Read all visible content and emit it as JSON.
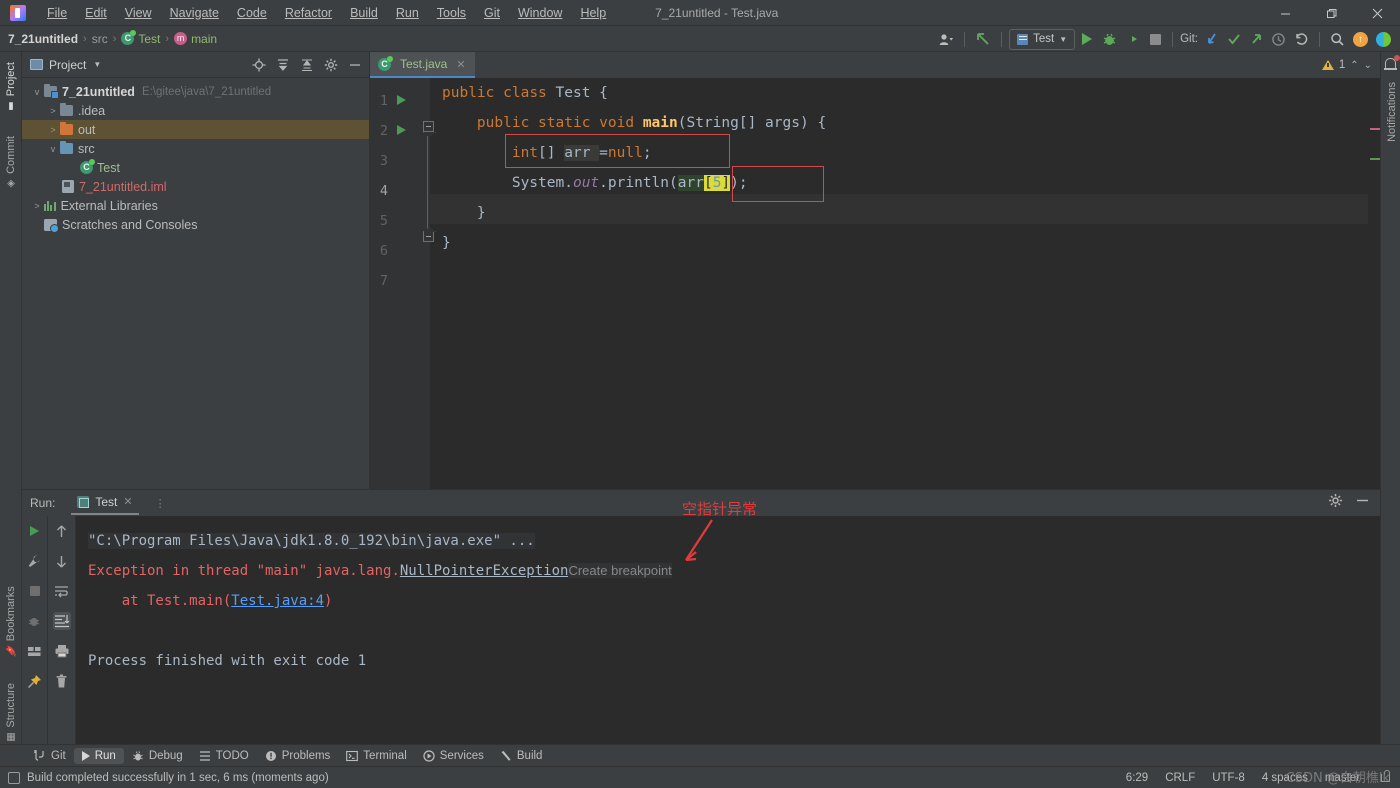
{
  "window": {
    "title": "7_21untitled - Test.java",
    "controls": {
      "minimize": "—",
      "maximize": "❐",
      "close": "✕"
    }
  },
  "menu": [
    {
      "label": "File"
    },
    {
      "label": "Edit"
    },
    {
      "label": "View"
    },
    {
      "label": "Navigate"
    },
    {
      "label": "Code"
    },
    {
      "label": "Refactor"
    },
    {
      "label": "Build"
    },
    {
      "label": "Run"
    },
    {
      "label": "Tools"
    },
    {
      "label": "Git"
    },
    {
      "label": "Window"
    },
    {
      "label": "Help"
    }
  ],
  "breadcrumb": {
    "project": "7_21untitled",
    "sep": "›",
    "src": "src",
    "class": "Test",
    "method": "main"
  },
  "toolbar": {
    "run_config": "Test",
    "git_label": "Git:",
    "icons": [
      "user-icon",
      "update-project-icon",
      "run-icon",
      "debug-icon",
      "run-coverage-icon",
      "stop-icon",
      "git-update-icon",
      "git-commit-icon",
      "git-push-icon",
      "git-history-icon",
      "git-rollback-icon",
      "search-icon",
      "notification-icon",
      "ide-feature-icon"
    ]
  },
  "left_strip": [
    {
      "label": "Project",
      "selected": true
    },
    {
      "label": "Commit",
      "selected": false
    }
  ],
  "left_strip_bottom": [
    {
      "label": "Bookmarks"
    },
    {
      "label": "Structure"
    }
  ],
  "right_strip": [
    {
      "label": "Notifications"
    }
  ],
  "project_panel": {
    "title": "Project",
    "actions": [
      "locate-icon",
      "expand-all-icon",
      "collapse-all-icon",
      "settings-icon",
      "hide-icon"
    ],
    "tree": [
      {
        "indent": 0,
        "arrow": "v",
        "icon": "module-folder",
        "label": "7_21untitled",
        "bold": true,
        "path": "E:\\gitee\\java\\7_21untitled",
        "selected": false
      },
      {
        "indent": 1,
        "arrow": ">",
        "icon": "folder-gray",
        "label": ".idea",
        "bold": false,
        "path": "",
        "selected": false
      },
      {
        "indent": 1,
        "arrow": ">",
        "icon": "folder-orange",
        "label": "out",
        "bold": false,
        "path": "",
        "selected": true
      },
      {
        "indent": 1,
        "arrow": "v",
        "icon": "folder-blue",
        "label": "src",
        "bold": false,
        "path": "",
        "selected": false
      },
      {
        "indent": 2,
        "arrow": "",
        "icon": "java-class",
        "label": "Test",
        "bold": false,
        "path": "",
        "selected": false
      },
      {
        "indent": 1,
        "arrow": "",
        "icon": "iml-file",
        "label": "7_21untitled.iml",
        "bold": false,
        "path": "",
        "selected": false
      },
      {
        "indent": 0,
        "arrow": ">",
        "icon": "libraries",
        "label": "External Libraries",
        "bold": false,
        "path": "",
        "selected": false
      },
      {
        "indent": 0,
        "arrow": "",
        "icon": "scratches",
        "label": "Scratches and Consoles",
        "bold": false,
        "path": "",
        "selected": false
      }
    ]
  },
  "editor": {
    "tab": {
      "label": "Test.java",
      "close": "✕"
    },
    "warnings": {
      "count": "1",
      "icon": "warning-triangle-icon"
    },
    "lines": [
      {
        "n": "1",
        "run_marker": true
      },
      {
        "n": "2",
        "run_marker": true
      },
      {
        "n": "3",
        "run_marker": false
      },
      {
        "n": "4",
        "run_marker": false
      },
      {
        "n": "5",
        "run_marker": false
      },
      {
        "n": "6",
        "run_marker": false
      },
      {
        "n": "7",
        "run_marker": false
      }
    ],
    "code": {
      "l1": "public class Test {",
      "l2": "public static void main(String[] args) {",
      "l3": "int[] arr =null;",
      "l4": "System.out.println(arr[5]);",
      "l5": "}",
      "l6": "}"
    }
  },
  "run_panel": {
    "label": "Run:",
    "tab": "Test",
    "tools_left": [
      "rerun-icon",
      "settings-wrench-icon",
      "stop-icon",
      "debug-icon",
      "layout-icon",
      "pin-icon"
    ],
    "tools_right": [
      "up-arrow-icon",
      "down-arrow-icon",
      "soft-wrap-icon",
      "scroll-to-end-icon",
      "print-icon",
      "trash-icon"
    ],
    "console": {
      "cmd": "\"C:\\Program Files\\Java\\jdk1.8.0_192\\bin\\java.exe\" ...",
      "exception_prefix": "Exception in thread \"main\" java.lang",
      "exception_dot": ".",
      "exception_name": "NullPointerException",
      "breakpoint_hint": "Create breakpoint",
      "stack_at": "    at Test.main(",
      "stack_link": "Test.java:4",
      "stack_close": ")",
      "finished": "Process finished with exit code 1"
    },
    "annotation": "空指针异常"
  },
  "tool_windows": [
    {
      "label": "Git",
      "icon": "git-icon",
      "selected": false
    },
    {
      "label": "Run",
      "icon": "run-icon",
      "selected": true
    },
    {
      "label": "Debug",
      "icon": "debug-icon",
      "selected": false
    },
    {
      "label": "TODO",
      "icon": "todo-icon",
      "selected": false
    },
    {
      "label": "Problems",
      "icon": "problems-icon",
      "selected": false
    },
    {
      "label": "Terminal",
      "icon": "terminal-icon",
      "selected": false
    },
    {
      "label": "Services",
      "icon": "services-icon",
      "selected": false
    },
    {
      "label": "Build",
      "icon": "build-icon",
      "selected": false
    }
  ],
  "status_bar": {
    "message": "Build completed successfully in 1 sec, 6 ms (moments ago)",
    "caret": "6:29",
    "line_sep": "CRLF",
    "encoding": "UTF-8",
    "indent": "4 spaces",
    "branch": "master"
  },
  "watermark": "CSDN @白朝樵lk",
  "colors": {
    "bg": "#3c3f41",
    "editor_bg": "#2b2b2b",
    "accent_blue": "#4a88c7",
    "error_red": "#e36464",
    "annotation_red": "#e03c3c",
    "selection": "#5d5233",
    "keyword": "#cc7832",
    "method": "#ffc66d",
    "number": "#6897bb",
    "static_field": "#9876aa"
  }
}
